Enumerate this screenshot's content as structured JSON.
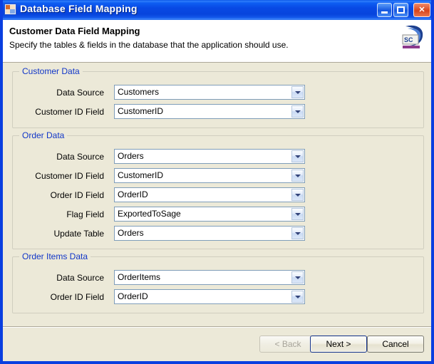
{
  "window": {
    "title": "Database Field Mapping",
    "icon": "form-window-icon",
    "controls": {
      "minimize": "minimize-button",
      "maximize": "maximize-button",
      "close": "close-button"
    }
  },
  "header": {
    "title": "Customer Data Field Mapping",
    "subtitle": "Specify the tables & fields in the database that the application should use.",
    "logo": "application-logo"
  },
  "groups": [
    {
      "legend": "Customer Data",
      "fields": [
        {
          "label": "Data Source",
          "value": "Customers"
        },
        {
          "label": "Customer ID Field",
          "value": "CustomerID"
        }
      ]
    },
    {
      "legend": "Order Data",
      "fields": [
        {
          "label": "Data Source",
          "value": "Orders"
        },
        {
          "label": "Customer ID Field",
          "value": "CustomerID"
        },
        {
          "label": "Order ID Field",
          "value": "OrderID"
        },
        {
          "label": "Flag Field",
          "value": "ExportedToSage"
        },
        {
          "label": "Update Table",
          "value": "Orders"
        }
      ]
    },
    {
      "legend": "Order Items Data",
      "fields": [
        {
          "label": "Data Source",
          "value": "OrderItems"
        },
        {
          "label": "Order ID Field",
          "value": "OrderID"
        }
      ]
    }
  ],
  "footer": {
    "back_label": "< Back",
    "next_label": "Next >",
    "cancel_label": "Cancel"
  },
  "colors": {
    "titlebar_blue": "#0a44de",
    "dialog_background": "#ece9d8",
    "group_legend_blue": "#1136c8",
    "combo_border": "#7f9db9",
    "close_button_red": "#d8451c"
  }
}
